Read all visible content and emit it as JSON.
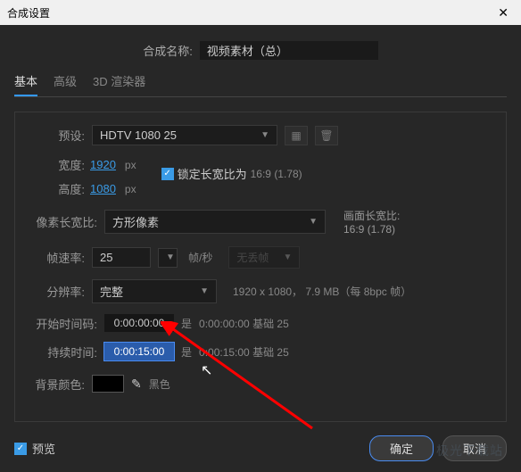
{
  "titlebar": {
    "title": "合成设置",
    "close": "✕"
  },
  "name": {
    "label": "合成名称:",
    "value": "视频素材（总）"
  },
  "tabs": {
    "basic": "基本",
    "advanced": "高级",
    "renderer": "3D 渲染器"
  },
  "preset": {
    "label": "预设:",
    "value": "HDTV 1080 25"
  },
  "width": {
    "label": "宽度:",
    "value": "1920",
    "unit": "px"
  },
  "height": {
    "label": "高度:",
    "value": "1080",
    "unit": "px"
  },
  "lock": {
    "text": "锁定长宽比为",
    "ratio": "16:9 (1.78)"
  },
  "par": {
    "label": "像素长宽比:",
    "value": "方形像素",
    "side_label": "画面长宽比:",
    "side_value": "16:9 (1.78)"
  },
  "fps": {
    "label": "帧速率:",
    "value": "25",
    "unit": "帧/秒",
    "drop": "无丢帧"
  },
  "res": {
    "label": "分辨率:",
    "value": "完整",
    "detail": "1920 x 1080， 7.9 MB（每 8bpc 帧）"
  },
  "start": {
    "label": "开始时间码:",
    "value": "0:00:00:00",
    "is": "是",
    "detail": "0:00:00:00 基础 25"
  },
  "duration": {
    "label": "持续时间:",
    "value": "0:00:15:00",
    "is": "是",
    "detail": "0:00:15:00 基础 25"
  },
  "bg": {
    "label": "背景颜色:",
    "name": "黑色"
  },
  "footer": {
    "preview": "预览",
    "ok": "确定",
    "cancel": "取消"
  },
  "watermark": "极光下载站"
}
